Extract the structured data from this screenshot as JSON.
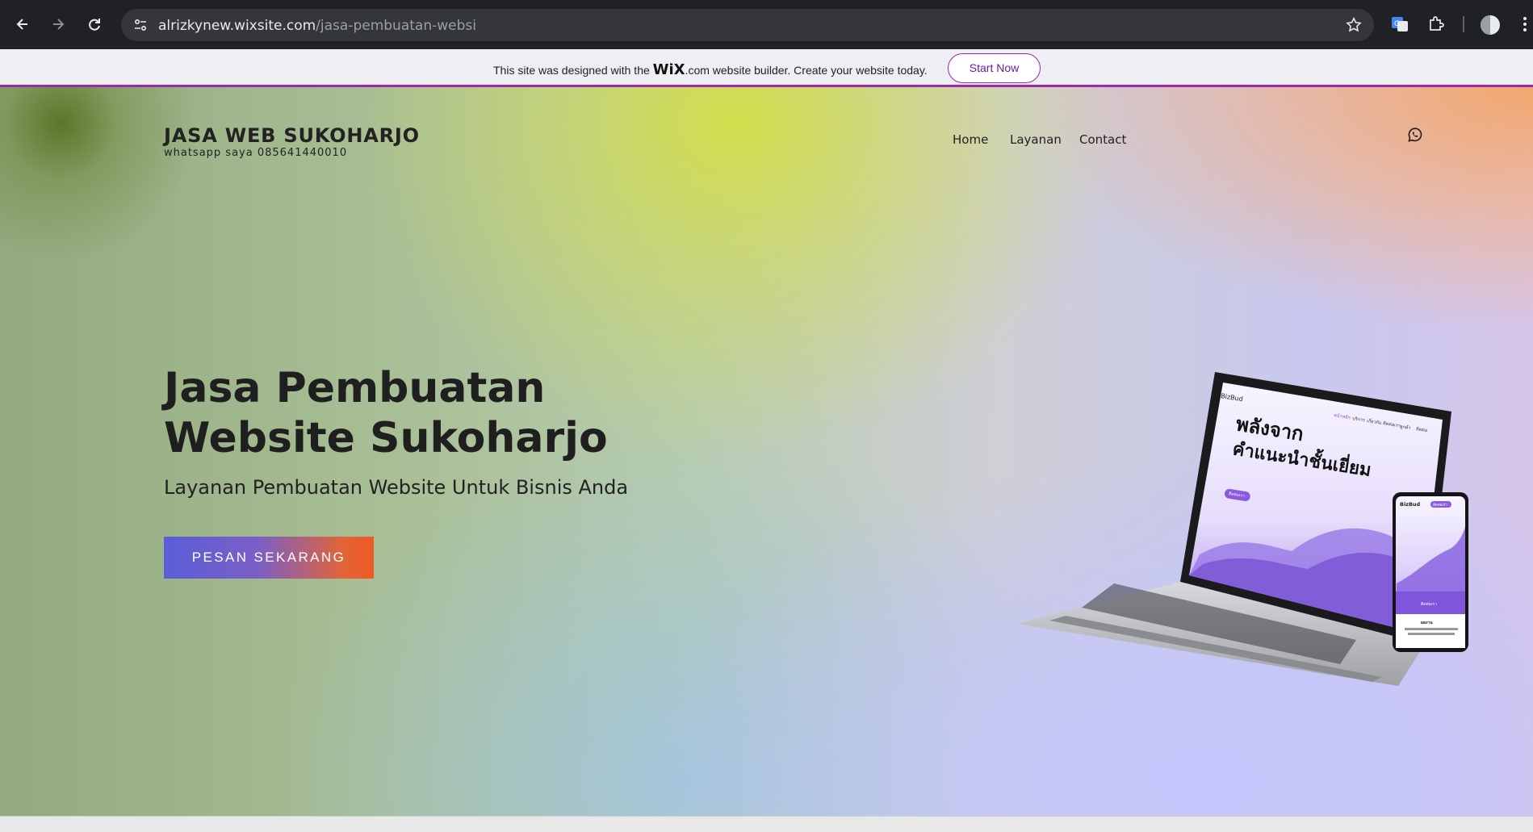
{
  "browser": {
    "url_host": "alrizkynew.wixsite.com",
    "url_path": "/jasa-pembuatan-websi",
    "back_icon": "arrow-left-icon",
    "forward_icon": "arrow-right-icon",
    "reload_icon": "reload-icon",
    "bookmark_icon": "star-icon",
    "translate_icon": "translate-icon",
    "extensions_icon": "puzzle-icon",
    "menu_icon": "kebab-icon"
  },
  "wix_banner": {
    "text_before": "This site was designed with the ",
    "logo": "WiX",
    "text_after": ".com website builder. Create your website today.",
    "button": "Start Now",
    "accent": "#9c27b0"
  },
  "header": {
    "title": "JASA WEB SUKOHARJO",
    "subtitle": "whatsapp  saya 085641440010",
    "nav": [
      "Home",
      "Layanan",
      "Contact"
    ],
    "social_icon": "whatsapp-icon"
  },
  "hero": {
    "heading_line1": "Jasa Pembuatan",
    "heading_line2": "Website Sukoharjo",
    "subheading": "Layanan Pembuatan Website Untuk Bisnis Anda",
    "cta": "PESAN SEKARANG"
  },
  "mockup": {
    "brand": "BizBud",
    "headline1": "พลังจาก",
    "headline2": "คำแนะนำชั้นเยี่ยม",
    "nav": [
      "หน้าหลัก",
      "บริการ",
      "เกี่ยวกับ",
      "ติดต่อเรา",
      "ลูกค้า",
      "ติดต่อ"
    ],
    "button": "ติดต่อเรา",
    "phone_button": "ติดต่อเรา",
    "phone_label": "ติดต่อเรา",
    "phone_caption": "ผลงาน"
  }
}
